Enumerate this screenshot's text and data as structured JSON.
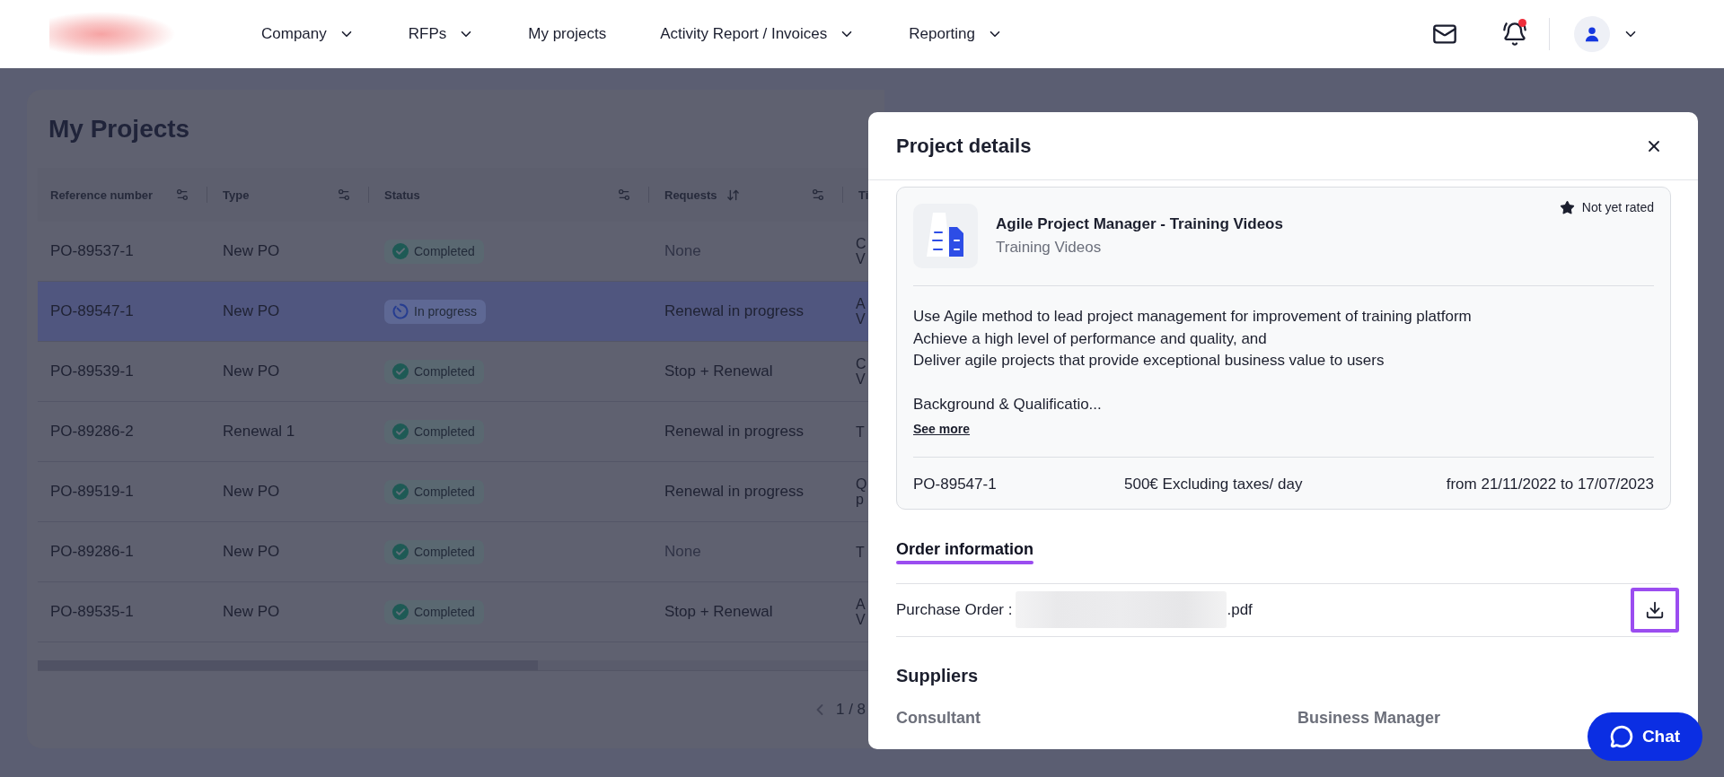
{
  "nav": {
    "items": [
      {
        "label": "Company",
        "dropdown": true
      },
      {
        "label": "RFPs",
        "dropdown": true
      },
      {
        "label": "My projects",
        "dropdown": false
      },
      {
        "label": "Activity Report / Invoices",
        "dropdown": true
      },
      {
        "label": "Reporting",
        "dropdown": true
      }
    ],
    "notifications": {
      "unread": true
    }
  },
  "page": {
    "title": "My Projects"
  },
  "table": {
    "columns": [
      {
        "label": "Reference number",
        "filter": true,
        "sort": false
      },
      {
        "label": "Type",
        "filter": true,
        "sort": false
      },
      {
        "label": "Status",
        "filter": true,
        "sort": false
      },
      {
        "label": "Requests",
        "filter": true,
        "sort": true
      },
      {
        "label": "Ti",
        "filter": false,
        "sort": false
      }
    ],
    "rows": [
      {
        "selected": false,
        "reference": "PO-89537-1",
        "type": "New PO",
        "status": {
          "kind": "completed",
          "label": "Completed"
        },
        "requests": {
          "text": "None",
          "empty": true
        },
        "column_5": "C\nV"
      },
      {
        "selected": true,
        "reference": "PO-89547-1",
        "type": "New PO",
        "status": {
          "kind": "in_progress",
          "label": "In progress"
        },
        "requests": {
          "text": "Renewal in progress",
          "empty": false
        },
        "column_5": "A\nV"
      },
      {
        "selected": false,
        "reference": "PO-89539-1",
        "type": "New PO",
        "status": {
          "kind": "completed",
          "label": "Completed"
        },
        "requests": {
          "text": "Stop + Renewal",
          "empty": false
        },
        "column_5": "C\nV"
      },
      {
        "selected": false,
        "reference": "PO-89286-2",
        "type": "Renewal 1",
        "status": {
          "kind": "completed",
          "label": "Completed"
        },
        "requests": {
          "text": "Renewal in progress",
          "empty": false
        },
        "column_5": "T"
      },
      {
        "selected": false,
        "reference": "PO-89519-1",
        "type": "New PO",
        "status": {
          "kind": "completed",
          "label": "Completed"
        },
        "requests": {
          "text": "Renewal in progress",
          "empty": false
        },
        "column_5": "Q\np"
      },
      {
        "selected": false,
        "reference": "PO-89286-1",
        "type": "New PO",
        "status": {
          "kind": "completed",
          "label": "Completed"
        },
        "requests": {
          "text": "None",
          "empty": true
        },
        "column_5": "T"
      },
      {
        "selected": false,
        "reference": "PO-89535-1",
        "type": "New PO",
        "status": {
          "kind": "completed",
          "label": "Completed"
        },
        "requests": {
          "text": "Stop + Renewal",
          "empty": false
        },
        "column_5": "A\nV"
      }
    ]
  },
  "pagination": {
    "page": "1 / 8"
  },
  "modal": {
    "title": "Project details",
    "project": {
      "title": "Agile Project Manager - Training Videos",
      "category": "Training Videos",
      "rating": "Not yet rated",
      "description": [
        "Use Agile method to lead project management for improvement of training platform\nAchieve a high level of performance and quality, and\nDeliver agile projects that provide exceptional business value to users",
        "Background & Qualificatio..."
      ],
      "see_more": "See more",
      "reference": "PO-89547-1",
      "rate": "500€ Excluding taxes/ day",
      "period": "from 21/11/2022 to 17/07/2023"
    },
    "order": {
      "title": "Order information",
      "purchase_order_label": "Purchase Order :",
      "file_extension": ".pdf",
      "download": {
        "highlighted": true
      }
    },
    "suppliers": {
      "title": "Suppliers",
      "columns": [
        "Consultant",
        "Business Manager"
      ]
    }
  },
  "chat": {
    "label": "Chat"
  }
}
